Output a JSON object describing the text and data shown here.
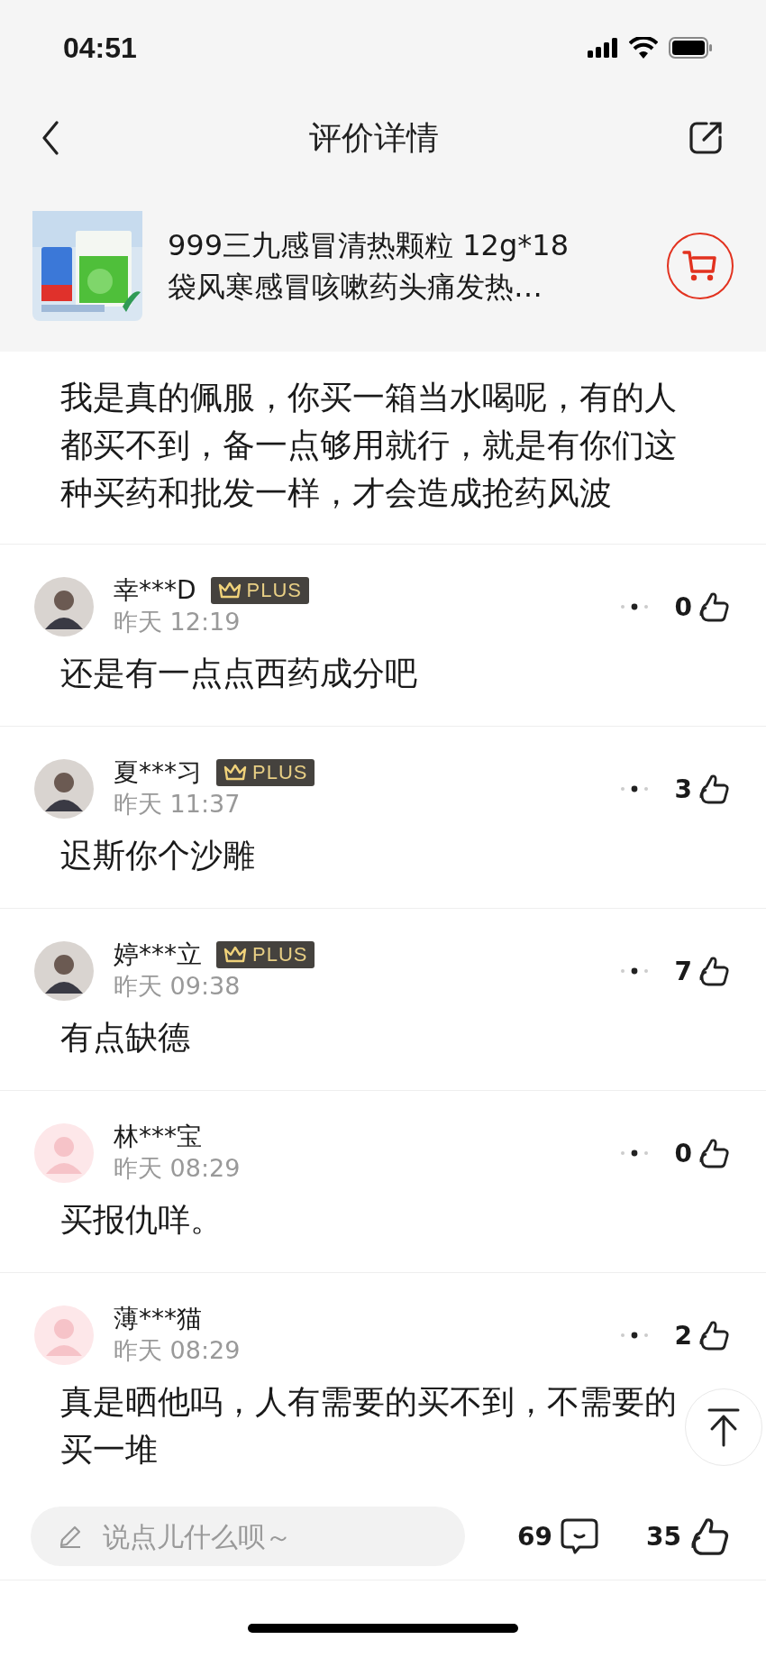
{
  "status_bar": {
    "time": "04:51"
  },
  "nav": {
    "title": "评价详情"
  },
  "product": {
    "title_lines": [
      "999三九感冒清热颗粒 12g*18",
      "袋风寒感冒咳嗽药头痛发热…"
    ]
  },
  "comments": [
    {
      "text": "我是真的佩服，你买一箱当水喝呢，有的人都买不到，备一点够用就行，就是有你们这种买药和批发一样，才会造成抢药风波"
    },
    {
      "user": "幸***D",
      "badge": "PLUS",
      "time": "昨天 12:19",
      "likes": "0",
      "text": "还是有一点点西药成分吧"
    },
    {
      "user": "夏***习",
      "badge": "PLUS",
      "time": "昨天 11:37",
      "likes": "3",
      "text": "迟斯你个沙雕"
    },
    {
      "user": "婷***立",
      "badge": "PLUS",
      "time": "昨天 09:38",
      "likes": "7",
      "text": "有点缺德"
    },
    {
      "user": "林***宝",
      "kind": "default",
      "time": "昨天 08:29",
      "likes": "0",
      "text": "买报仇咩。"
    },
    {
      "user": "薄***猫",
      "kind": "default",
      "time": "昨天 08:29",
      "likes": "2",
      "text": "真是晒他吗，人有需要的买不到，不需要的买一堆"
    }
  ],
  "bottom_bar": {
    "placeholder": "说点儿什么呗～",
    "comment_count": "69",
    "like_count": "35"
  }
}
